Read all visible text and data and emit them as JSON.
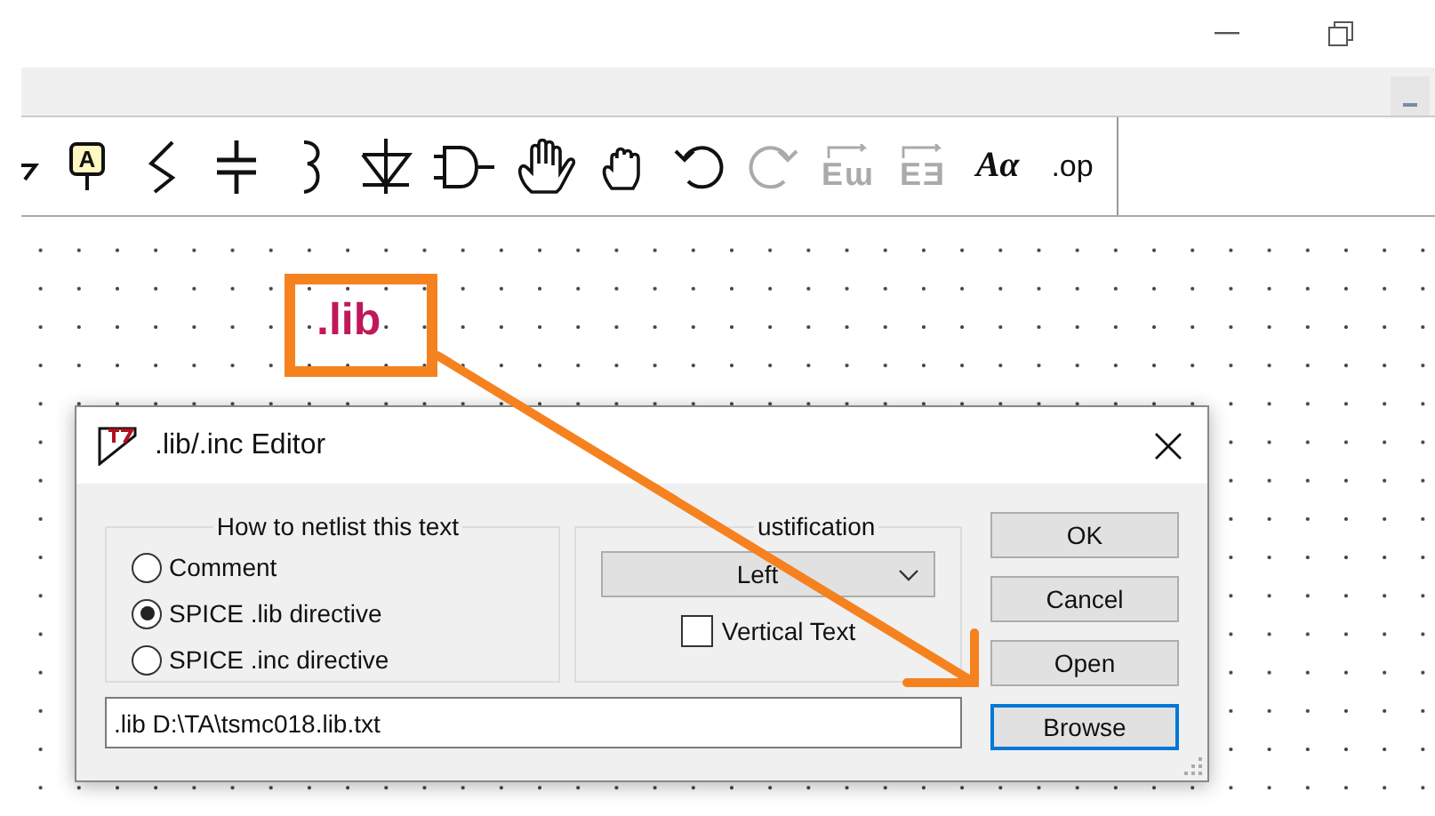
{
  "window": {
    "controls": [
      {
        "kind": "minimize"
      },
      {
        "kind": "restore"
      }
    ]
  },
  "menu_bar": {
    "controls": [
      {
        "kind": "minimize"
      }
    ]
  },
  "toolbar": [
    {
      "kind": "partial",
      "disabled": false
    },
    {
      "kind": "label",
      "glyph": "A",
      "disabled": false
    },
    {
      "kind": "resistor",
      "disabled": false
    },
    {
      "kind": "capacitor",
      "disabled": false
    },
    {
      "kind": "inductor",
      "disabled": false
    },
    {
      "kind": "diode",
      "disabled": false
    },
    {
      "kind": "component",
      "disabled": false
    },
    {
      "kind": "drag",
      "disabled": false
    },
    {
      "kind": "move",
      "disabled": false
    },
    {
      "kind": "undo",
      "disabled": false
    },
    {
      "kind": "redo",
      "disabled": true
    },
    {
      "kind": "rotate",
      "glyph": "Eɯ",
      "disabled": true
    },
    {
      "kind": "mirror",
      "glyph": "EƎ",
      "disabled": true
    },
    {
      "kind": "text",
      "glyph": "Aα",
      "disabled": false
    },
    {
      "kind": "directive",
      "glyph": ".op",
      "disabled": false
    }
  ],
  "canvas": {
    "text": ".lib"
  },
  "dialog": {
    "title": ".lib/.inc Editor",
    "netlist_group": {
      "title": "How to netlist this text",
      "options": [
        {
          "label": "Comment",
          "selected": false
        },
        {
          "label": "SPICE .lib directive",
          "selected": true
        },
        {
          "label": "SPICE .inc directive",
          "selected": false
        }
      ]
    },
    "justification_group": {
      "title": "ustification",
      "dropdown": {
        "value": "Left"
      },
      "vertical_text": {
        "label": "Vertical Text",
        "checked": false
      }
    },
    "text_field": {
      "value": ".lib D:\\TA\\tsmc018.lib.txt"
    },
    "buttons": [
      {
        "label": "OK",
        "default": false
      },
      {
        "label": "Cancel",
        "default": false
      },
      {
        "label": "Open",
        "default": false
      },
      {
        "label": "Browse",
        "default": true
      }
    ]
  }
}
